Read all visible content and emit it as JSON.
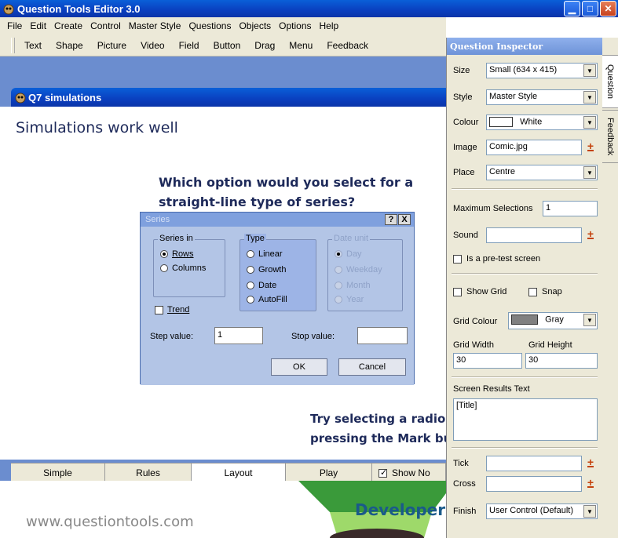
{
  "app": {
    "title": "Question Tools Editor 3.0"
  },
  "menu": [
    "File",
    "Edit",
    "Create",
    "Control",
    "Master Style",
    "Questions",
    "Objects",
    "Options",
    "Help"
  ],
  "toolbar": [
    "Text",
    "Shape",
    "Picture",
    "Video",
    "Field",
    "Button",
    "Drag",
    "Menu",
    "Feedback"
  ],
  "child_window": {
    "title": "Q7 simulations"
  },
  "canvas": {
    "heading": "Simulations work well",
    "question_line1": "Which option would you select for a",
    "question_line2": "straight-line type of series?",
    "try_line1": "Try selecting a radio",
    "try_line2": "pressing the Mark bu"
  },
  "dialog": {
    "title": "Series",
    "help_btn": "?",
    "close_btn": "X",
    "series_in_label": "Series in",
    "series_in": [
      "Rows",
      "Columns"
    ],
    "type_label": "Type",
    "type": [
      "Linear",
      "Growth",
      "Date",
      "AutoFill"
    ],
    "date_unit_label": "Date unit",
    "date_unit": [
      "Day",
      "Weekday",
      "Month",
      "Year"
    ],
    "trend_label": "Trend",
    "step_label": "Step value:",
    "step_value": "1",
    "stop_label": "Stop value:",
    "stop_value": "",
    "ok": "OK",
    "cancel": "Cancel"
  },
  "tabs": [
    "Simple",
    "Rules",
    "Layout",
    "Play",
    "Show No"
  ],
  "background": {
    "url": "www.questiontools.com",
    "developer": "Developer"
  },
  "inspector": {
    "title": "Question Inspector",
    "side_tabs": [
      "Question",
      "Feedback"
    ],
    "size_label": "Size",
    "size_value": "Small (634 x 415)",
    "style_label": "Style",
    "style_value": "Master Style",
    "colour_label": "Colour",
    "colour_value": "White",
    "colour_hex": "#ffffff",
    "image_label": "Image",
    "image_value": "Comic.jpg",
    "place_label": "Place",
    "place_value": "Centre",
    "max_sel_label": "Maximum Selections",
    "max_sel_value": "1",
    "sound_label": "Sound",
    "sound_value": "",
    "pretest_label": "Is a pre-test screen",
    "show_grid_label": "Show Grid",
    "snap_label": "Snap",
    "grid_colour_label": "Grid Colour",
    "grid_colour_value": "Gray",
    "grid_colour_hex": "#808080",
    "grid_width_label": "Grid Width",
    "grid_width_value": "30",
    "grid_height_label": "Grid Height",
    "grid_height_value": "30",
    "results_label": "Screen Results Text",
    "results_value": "[Title]",
    "tick_label": "Tick",
    "tick_value": "",
    "cross_label": "Cross",
    "cross_value": "",
    "finish_label": "Finish",
    "finish_value": "User Control (Default)"
  }
}
